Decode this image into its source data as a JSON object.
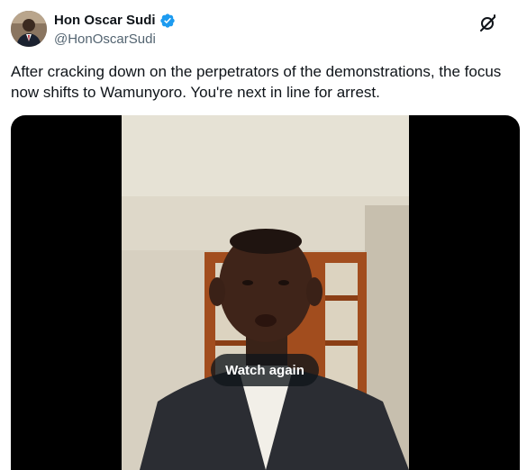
{
  "tweet": {
    "author": {
      "display_name": "Hon Oscar Sudi",
      "handle": "@HonOscarSudi",
      "verified": true,
      "verified_color": "#1d9bf0"
    },
    "text": "After cracking down on the perpetrators of the demonstrations, the focus now shifts to Wamunyoro. You're next in line for arrest.",
    "media": {
      "type": "video",
      "overlay_button": "Watch again"
    },
    "icons": {
      "top_right": "grok-icon",
      "verified": "verified-badge-icon"
    }
  }
}
